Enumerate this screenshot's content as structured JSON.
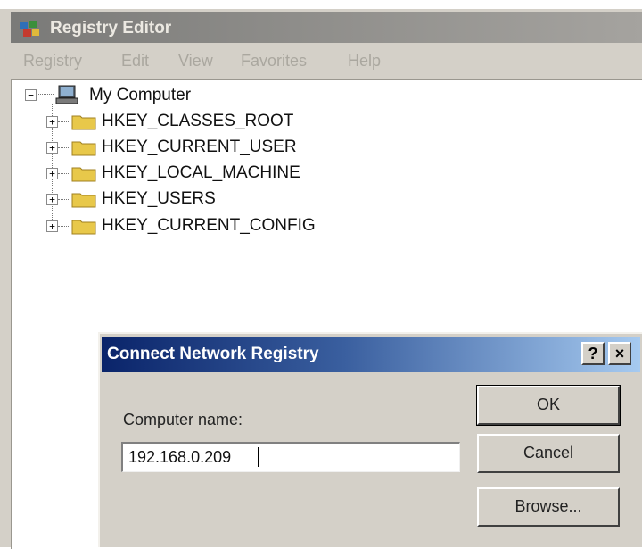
{
  "window": {
    "title": "Registry Editor",
    "menu": [
      "Registry",
      "Edit",
      "View",
      "Favorites",
      "Help"
    ]
  },
  "tree": {
    "root": {
      "label": "My Computer",
      "expander": "−"
    },
    "children": [
      {
        "label": "HKEY_CLASSES_ROOT",
        "expander": "+"
      },
      {
        "label": "HKEY_CURRENT_USER",
        "expander": "+"
      },
      {
        "label": "HKEY_LOCAL_MACHINE",
        "expander": "+"
      },
      {
        "label": "HKEY_USERS",
        "expander": "+"
      },
      {
        "label": "HKEY_CURRENT_CONFIG",
        "expander": "+"
      }
    ]
  },
  "dialog": {
    "title": "Connect Network Registry",
    "help_glyph": "?",
    "close_glyph": "×",
    "field_label": "Computer name:",
    "computer_name": "192.168.0.209",
    "buttons": {
      "ok": "OK",
      "cancel": "Cancel",
      "browse": "Browse..."
    }
  },
  "colors": {
    "dialog_title_start": "#0a246a",
    "dialog_title_end": "#a6caf0",
    "window_face": "#d4d0c8",
    "folder_yellow": "#e8c84a"
  },
  "icons": {
    "app": "registry-editor-icon",
    "root": "computer-icon",
    "keys": "folder-icon"
  }
}
